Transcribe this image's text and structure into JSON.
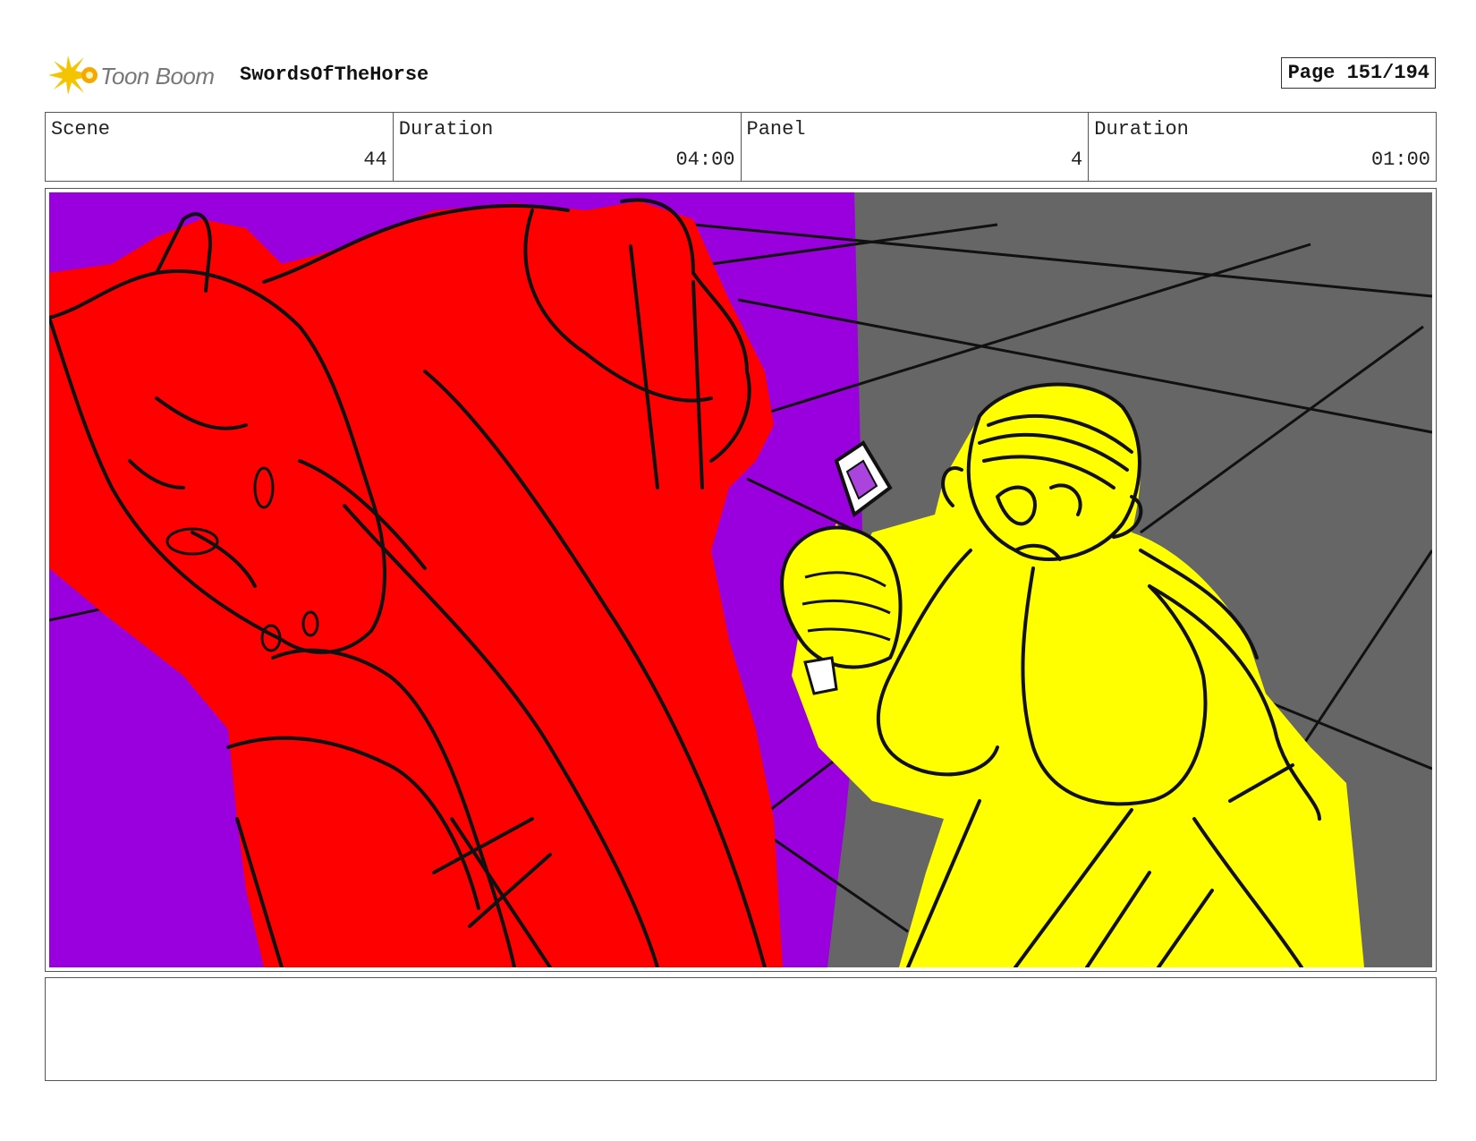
{
  "header": {
    "logo_text": "Toon Boom",
    "project_title": "SwordsOfTheHorse",
    "page_label": "Page 151/194"
  },
  "info": {
    "scene_label": "Scene",
    "scene_value": "44",
    "scene_duration_label": "Duration",
    "scene_duration_value": "04:00",
    "panel_label": "Panel",
    "panel_value": "4",
    "panel_duration_label": "Duration",
    "panel_duration_value": "01:00"
  },
  "colors": {
    "background_left": "#9900dd",
    "background_right": "#666666",
    "horse": "#ff0000",
    "character": "#ffff00",
    "logo_accent": "#f5c400"
  },
  "notes": {
    "text": ""
  }
}
